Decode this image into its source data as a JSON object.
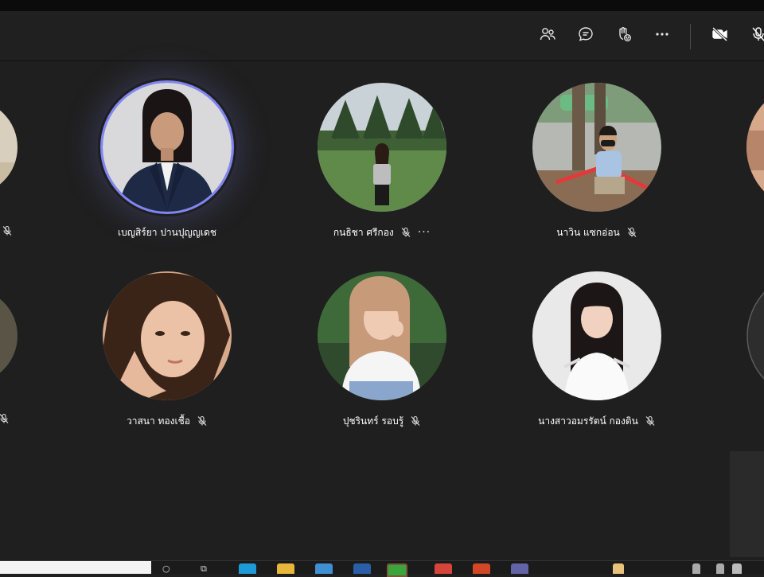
{
  "window": {
    "title": ""
  },
  "toolbar": {
    "buttons": [
      {
        "id": "participants",
        "icon": "people-icon"
      },
      {
        "id": "chat",
        "icon": "chat-icon"
      },
      {
        "id": "reactions",
        "icon": "raise-hand-icon"
      },
      {
        "id": "more",
        "icon": "more-icon"
      },
      {
        "id": "camera",
        "icon": "camera-off-icon"
      },
      {
        "id": "mic",
        "icon": "mic-off-icon"
      }
    ]
  },
  "participants": [
    {
      "name": "เบญสิร์ยา ปานปุญญเดช",
      "muted": false,
      "speaking": true,
      "row": 1
    },
    {
      "name": "กนธิชา ศรีกอง",
      "muted": true,
      "speaking": false,
      "row": 1,
      "has_more": true,
      "more_label": "···"
    },
    {
      "name": "นาวิน แซกอ่อน",
      "muted": true,
      "speaking": false,
      "row": 1
    },
    {
      "name": "วาสนา ทองเชื้อ",
      "muted": true,
      "speaking": false,
      "row": 2
    },
    {
      "name": "ปุชรินทร์ รอบรู้",
      "muted": true,
      "speaking": false,
      "row": 2
    },
    {
      "name": "นางสาวอมรรัตน์ กองดิน",
      "muted": true,
      "speaking": false,
      "row": 2
    }
  ],
  "colors": {
    "background": "#1f1f1f",
    "toolbar": "#202020",
    "speaking_ring": "#7f85f5",
    "text": "#ffffff"
  },
  "taskbar": {
    "icons": [
      "search-icon",
      "task-view-icon",
      "edge-icon",
      "file-explorer-icon",
      "store-icon",
      "app-icon",
      "line-icon",
      "chrome-icon",
      "office-icon",
      "teams-icon"
    ]
  }
}
